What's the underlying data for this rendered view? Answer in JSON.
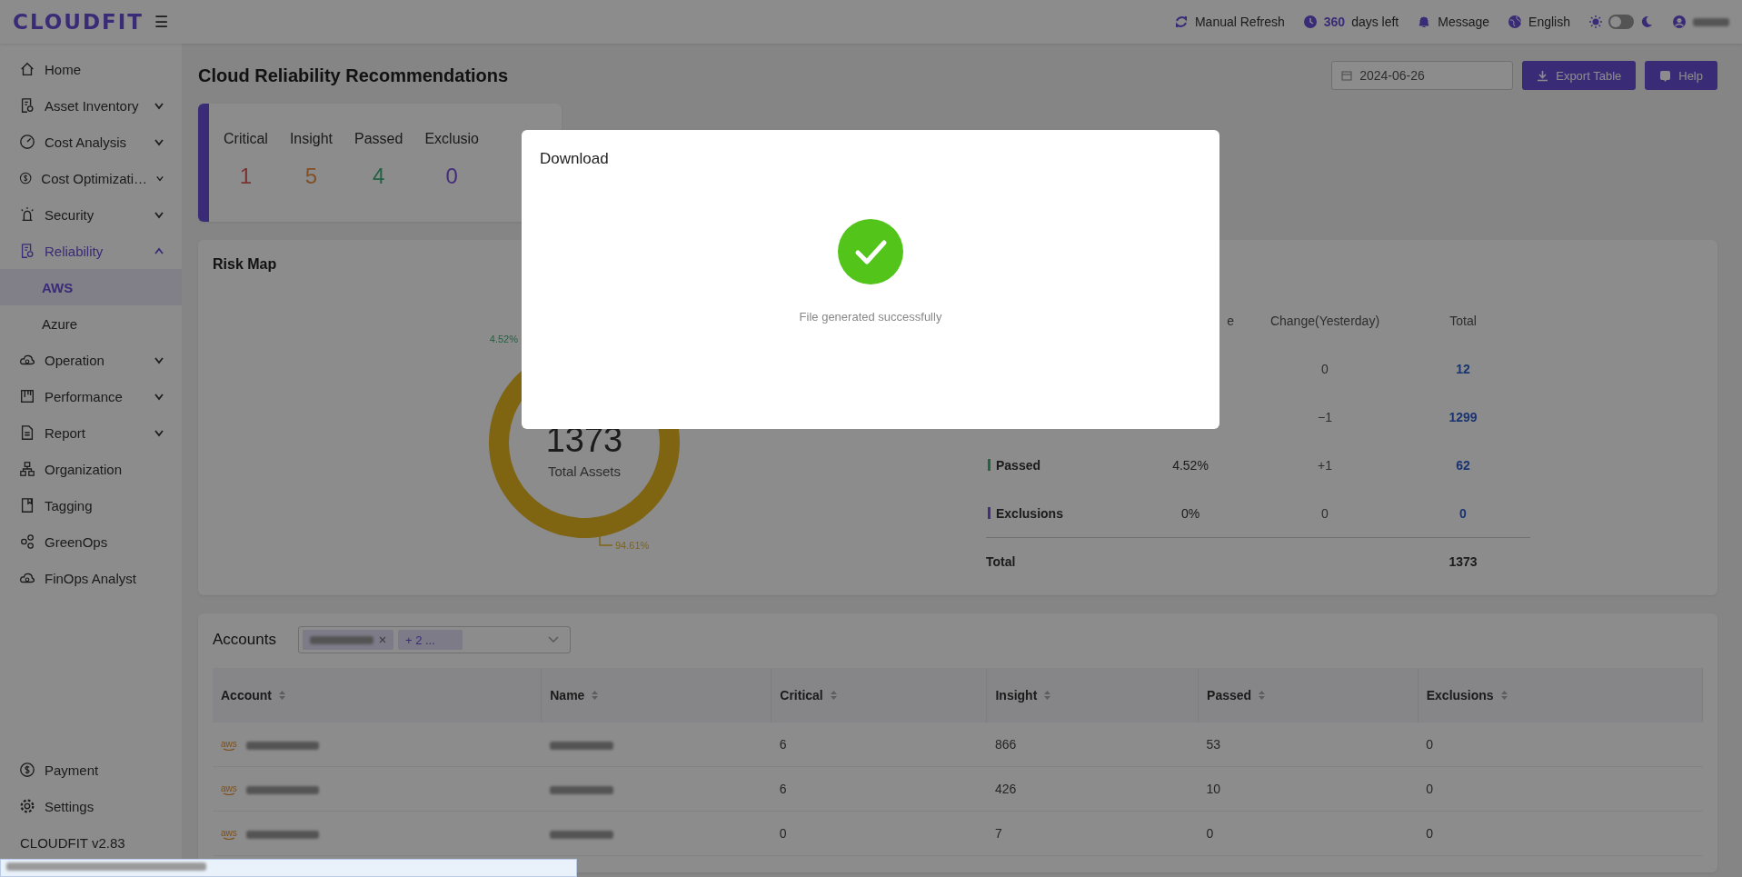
{
  "topbar": {
    "logo": "CLOUDFIT",
    "menu_icon": "☰",
    "refresh": "Manual Refresh",
    "days": "360",
    "days_suffix": "days left",
    "message": "Message",
    "language": "English",
    "dark_mode": false
  },
  "sidebar": {
    "items": [
      {
        "label": "Home",
        "selected": false
      },
      {
        "label": "Asset Inventory",
        "expanded": false,
        "selected": false
      },
      {
        "label": "Cost Analysis",
        "expanded": false,
        "selected": false
      },
      {
        "label": "Cost Optimizati…",
        "expanded": false,
        "selected": false
      },
      {
        "label": "Security",
        "expanded": false,
        "selected": false
      },
      {
        "label": "Reliability",
        "expanded": true,
        "selected": true,
        "children": [
          {
            "label": "AWS",
            "selected": true
          },
          {
            "label": "Azure",
            "selected": false
          }
        ]
      },
      {
        "label": "Operation",
        "expanded": false,
        "selected": false
      },
      {
        "label": "Performance",
        "expanded": false,
        "selected": false
      },
      {
        "label": "Report",
        "expanded": false,
        "selected": false
      },
      {
        "label": "Organization",
        "selected": false
      },
      {
        "label": "Tagging",
        "selected": false
      },
      {
        "label": "GreenOps",
        "selected": false
      },
      {
        "label": "FinOps Analyst",
        "selected": false
      }
    ],
    "bottom_items": [
      {
        "label": "Payment"
      },
      {
        "label": "Settings"
      }
    ],
    "version": "CLOUDFIT v2.83"
  },
  "page": {
    "title": "Cloud Reliability Recommendations",
    "date": "2024-06-26",
    "buttons": [
      "Export Table",
      "Help"
    ]
  },
  "summary": [
    {
      "label": "Critical",
      "value": "1",
      "color": "#7b3232"
    },
    {
      "label": "Insight",
      "value": "5",
      "color": "#805029"
    },
    {
      "label": "Passed",
      "value": "4",
      "color": "#236243"
    },
    {
      "label": "Exclusio",
      "value": "0",
      "color": "#442d7b"
    }
  ],
  "risk_map": {
    "title": "Risk Map",
    "donut_labels": [
      "4.52%",
      "94.61%"
    ],
    "total": "1373",
    "total_label": "Total Assets",
    "columns": [
      "e",
      "Change(Yesterday)",
      "Total"
    ],
    "rows": [
      {
        "change": "0",
        "total": "12"
      },
      {
        "change": "−1",
        "total": "1299"
      },
      {
        "label": "Passed",
        "color": "#236243",
        "percentage": "4.52%",
        "change": "+1",
        "total": "62"
      },
      {
        "label": "Exclusions",
        "color": "#442d7b",
        "percentage": "0%",
        "change": "0",
        "total": "0"
      }
    ],
    "total_row": {
      "label": "Total",
      "total": "1373"
    }
  },
  "accounts": {
    "title": "Accounts",
    "extra_tag": "+ 2 ...",
    "columns": [
      "Account",
      "Name",
      "Critical",
      "Insight",
      "Passed",
      "Exclusions"
    ],
    "rows": [
      {
        "provider": "aws",
        "critical": "6",
        "insight": "866",
        "passed": "53",
        "exclusions": "0"
      },
      {
        "provider": "aws",
        "critical": "6",
        "insight": "426",
        "passed": "10",
        "exclusions": "0"
      },
      {
        "provider": "aws",
        "critical": "0",
        "insight": "7",
        "passed": "0",
        "exclusions": "0"
      }
    ]
  },
  "modal": {
    "title": "Download",
    "message": "File generated successfully"
  }
}
